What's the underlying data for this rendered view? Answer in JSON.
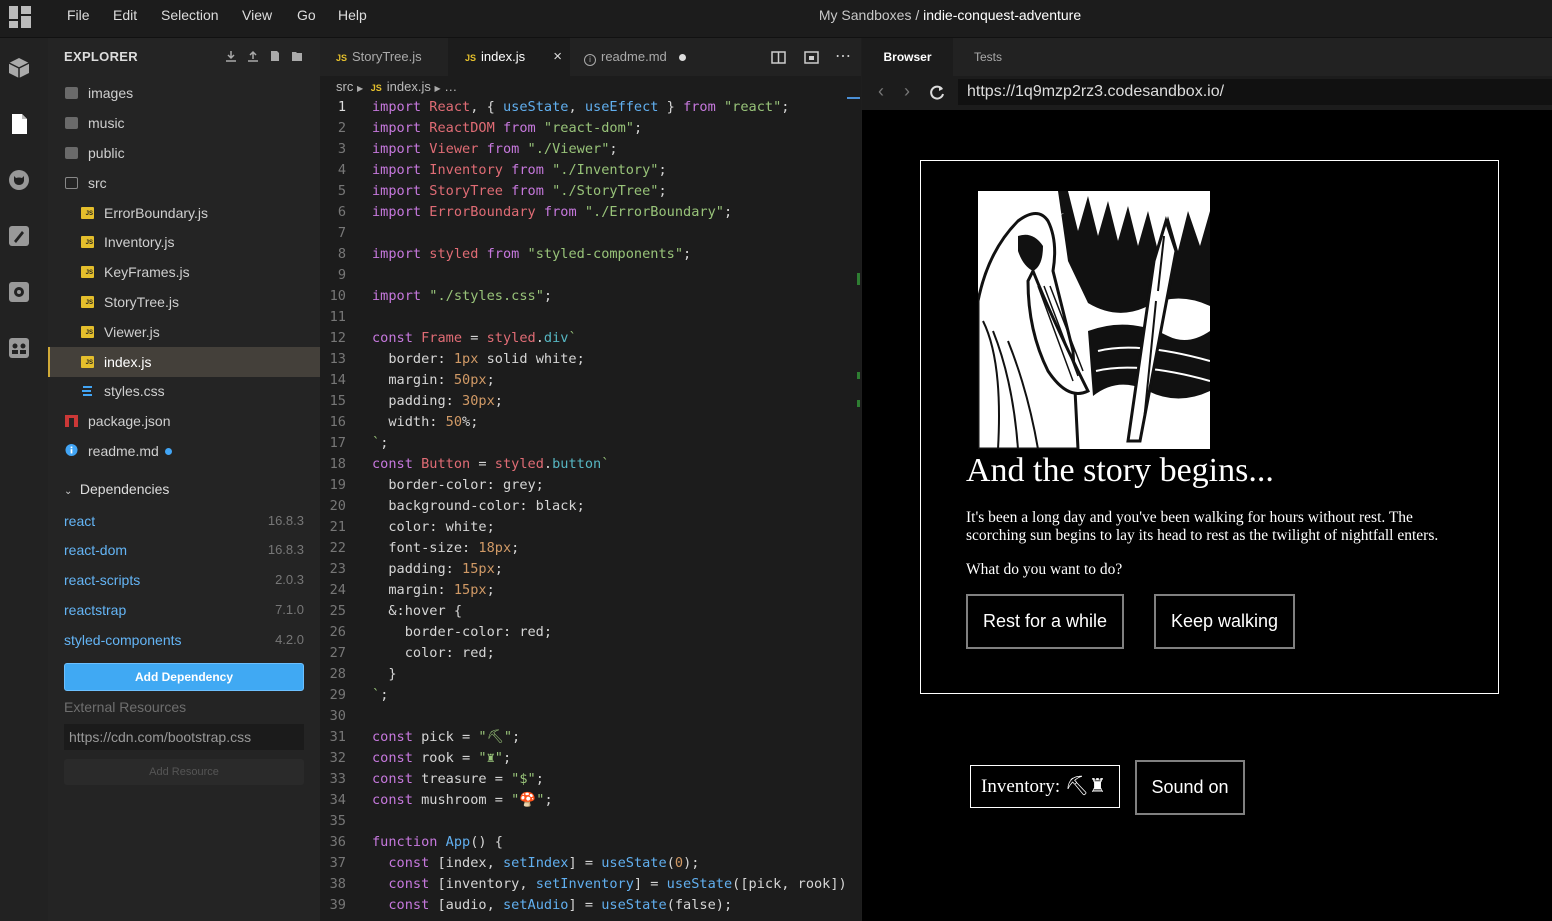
{
  "menu": [
    "File",
    "Edit",
    "Selection",
    "View",
    "Go",
    "Help"
  ],
  "title": {
    "prefix": "My Sandboxes /",
    "name": "indie-conquest-adventure"
  },
  "sidebar": {
    "title": "EXPLORER",
    "files": [
      {
        "label": "images",
        "type": "folder"
      },
      {
        "label": "music",
        "type": "folder"
      },
      {
        "label": "public",
        "type": "folder"
      },
      {
        "label": "src",
        "type": "folder-open"
      },
      {
        "label": "ErrorBoundary.js",
        "type": "js"
      },
      {
        "label": "Inventory.js",
        "type": "js"
      },
      {
        "label": "KeyFrames.js",
        "type": "js"
      },
      {
        "label": "StoryTree.js",
        "type": "js"
      },
      {
        "label": "Viewer.js",
        "type": "js"
      },
      {
        "label": "index.js",
        "type": "js"
      },
      {
        "label": "styles.css",
        "type": "css"
      },
      {
        "label": "package.json",
        "type": "npm"
      },
      {
        "label": "readme.md",
        "type": "info"
      }
    ],
    "deps_title": "Dependencies",
    "deps": [
      {
        "name": "react",
        "version": "16.8.3"
      },
      {
        "name": "react-dom",
        "version": "16.8.3"
      },
      {
        "name": "react-scripts",
        "version": "2.0.3"
      },
      {
        "name": "reactstrap",
        "version": "7.1.0"
      },
      {
        "name": "styled-components",
        "version": "4.2.0"
      }
    ],
    "add_dep": "Add Dependency",
    "ext_label": "External Resources",
    "ext_value": "https://cdn.com/bootstrap.css",
    "add_res": "Add Resource"
  },
  "editor": {
    "tabs": [
      {
        "label": "StoryTree.js",
        "active": false
      },
      {
        "label": "index.js",
        "active": true
      },
      {
        "label": "readme.md",
        "active": false
      }
    ],
    "crumb": [
      "src",
      "index.js",
      "…"
    ],
    "lines": [
      "import React, { useState, useEffect } from \"react\";",
      "import ReactDOM from \"react-dom\";",
      "import Viewer from \"./Viewer\";",
      "import Inventory from \"./Inventory\";",
      "import StoryTree from \"./StoryTree\";",
      "import ErrorBoundary from \"./ErrorBoundary\";",
      "",
      "import styled from \"styled-components\";",
      "",
      "import \"./styles.css\";",
      "",
      "const Frame = styled.div`",
      "  border: 1px solid white;",
      "  margin: 50px;",
      "  padding: 30px;",
      "  width: 50%;",
      "`;",
      "const Button = styled.button`",
      "  border-color: grey;",
      "  background-color: black;",
      "  color: white;",
      "  font-size: 18px;",
      "  padding: 15px;",
      "  margin: 15px;",
      "  &:hover {",
      "    border-color: red;",
      "    color: red;",
      "  }",
      "`;",
      "",
      "const pick = \"⛏\";",
      "const rook = \"♜\";",
      "const treasure = \"$\";",
      "const mushroom = \"🍄\";",
      "",
      "function App() {",
      "  const [index, setIndex] = useState(0);",
      "  const [inventory, setInventory] = useState([pick, rook])",
      "  const [audio, setAudio] = useState(false);"
    ]
  },
  "browser": {
    "tabs": [
      "Browser",
      "Tests"
    ],
    "url": "https://1q9mzp2rz3.codesandbox.io/",
    "story_title": "And the story begins...",
    "story_text": "It's been a long day and you've been walking for hours without rest. The scorching sun begins to lay its head to rest as the twilight of nightfall enters.",
    "prompt": "What do you want to do?",
    "choice1": "Rest for a while",
    "choice2": "Keep walking",
    "inventory": "Inventory: ⛏♜",
    "sound": "Sound on"
  }
}
